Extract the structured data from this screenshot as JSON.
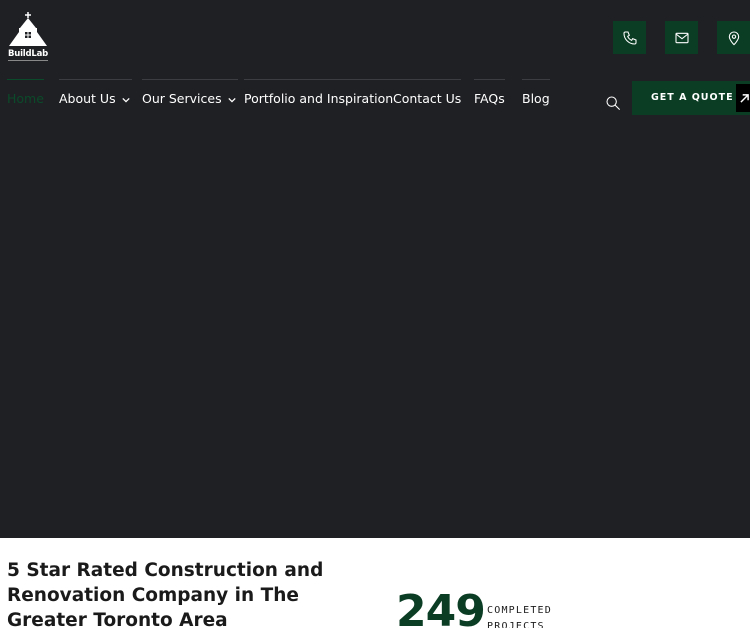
{
  "brand": {
    "name": "BuildLab",
    "accent_color": "#0b3d24",
    "hero_bg": "#1f2024"
  },
  "header": {
    "contact_icons": [
      "phone-icon",
      "mail-icon",
      "location-icon"
    ]
  },
  "nav": {
    "items": [
      {
        "label": "Home",
        "active": true
      },
      {
        "label": "About Us",
        "dropdown": true
      },
      {
        "label": "Our Services",
        "dropdown": true
      },
      {
        "label": "Portfolio and Inspiration"
      },
      {
        "label": "Contact Us"
      },
      {
        "label": "FAQs"
      },
      {
        "label": "Blog"
      }
    ],
    "quote_label": "GET A QUOTE"
  },
  "intro": {
    "headline": "5 Star Rated Construction and Renovation Company in The Greater Toronto Area",
    "stat_value": "249",
    "stat_label_line1": "COMPLETED",
    "stat_label_line2": "PROJECTS"
  }
}
